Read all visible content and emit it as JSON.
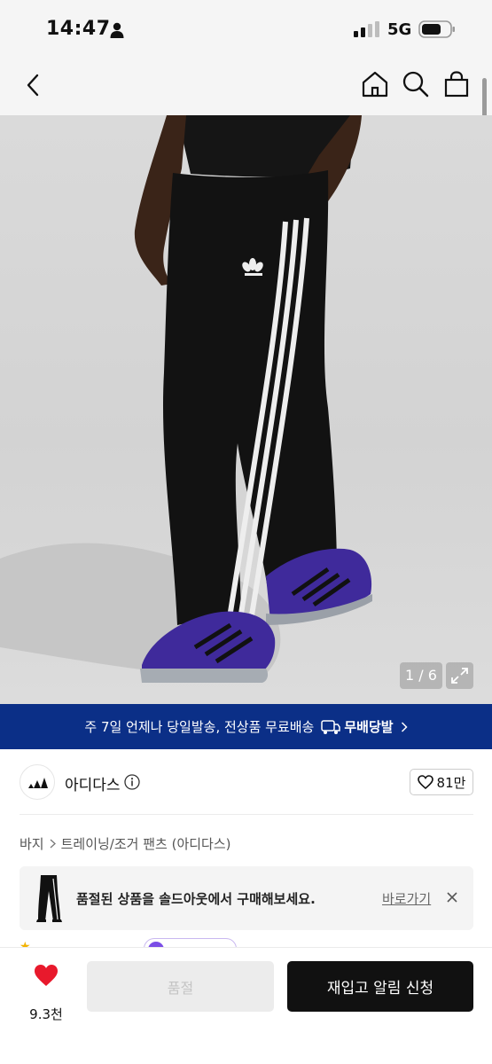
{
  "status_bar": {
    "time": "14:47",
    "network": "5G"
  },
  "nav": {
    "back_icon": "chevron-left-icon",
    "home_icon": "home-icon",
    "search_icon": "search-icon",
    "bag_icon": "shopping-bag-icon"
  },
  "gallery": {
    "counter": "1 / 6",
    "expand_icon": "expand-icon"
  },
  "banner": {
    "text": "주 7일 언제나 당일발송, 전상품 무료배송",
    "badge_label": "무배당발",
    "background": "#0b2f87"
  },
  "brand": {
    "name": "아디다스",
    "like_count": "81만"
  },
  "breadcrumb": {
    "items": [
      "바지",
      "트레이닝/조거 팬츠 (아디다스)"
    ]
  },
  "notice": {
    "text": "품절된 상품을 솔드아웃에서 구매해보세요.",
    "link_label": "바로가기"
  },
  "bottom_bar": {
    "wish_count": "9.3천",
    "soldout_label": "품절",
    "restock_label": "재입고 알림 신청",
    "accent": "#e8192c"
  }
}
